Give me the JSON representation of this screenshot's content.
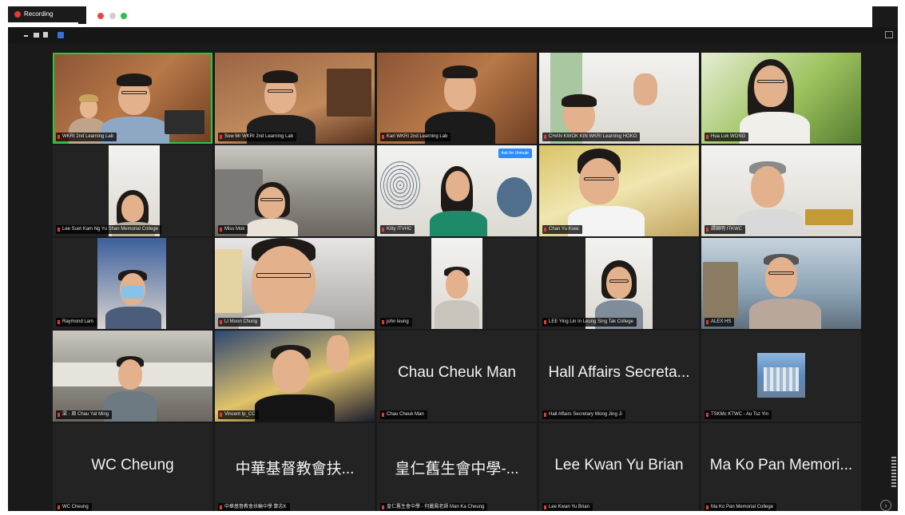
{
  "window": {
    "recording_label": "Recording",
    "accent": "#27c93f",
    "record_color": "#e53935"
  },
  "participants": [
    {
      "name": "WKRI 2nd Learning Lab",
      "video": true
    },
    {
      "name": "Sow Mr WKRI 2nd Learning Lab",
      "video": true
    },
    {
      "name": "Karl WKRI 2nd Learning Lab",
      "video": true
    },
    {
      "name": "CHAN KWOK KIN WKRI Learning HOKO",
      "video": true
    },
    {
      "name": "Hua Lok WONG",
      "video": true
    },
    {
      "name": "Lee Suet Kam Ng Yu Shan Memorial College",
      "video": true
    },
    {
      "name": "Miss Mok",
      "video": true
    },
    {
      "name": "Kitty ITVHC",
      "video": true,
      "badge": "Ask for Unmute"
    },
    {
      "name": "Chan Yu Kwai",
      "video": true
    },
    {
      "name": "譚錦明 ITKWC",
      "video": true
    },
    {
      "name": "Raymond Lam",
      "video": true
    },
    {
      "name": "LI Moon Chung",
      "video": true
    },
    {
      "name": "john leung",
      "video": true
    },
    {
      "name": "LEE Ying Lin In Leung Sing Tak College",
      "video": true
    },
    {
      "name": "ALEX HS",
      "video": true
    },
    {
      "name": "梁 - 周 Chau Yat Ming",
      "video": true
    },
    {
      "name": "Vincent Ip_CC",
      "video": true
    },
    {
      "name": "Chau Cheuk Man",
      "display": "Chau Cheuk Man",
      "video": false
    },
    {
      "name": "Hall Affairs Secretary Wong Jing Ji",
      "display": "Hall Affairs Secreta...",
      "video": false
    },
    {
      "name": "TSKMc KTWC - Au Tsz Yin",
      "video": false,
      "picture": true
    },
    {
      "name": "WC Cheung",
      "display": "WC Cheung",
      "video": false
    },
    {
      "name": "中華基督教會扶輪中學 鄭志K",
      "display": "中華基督教會扶...",
      "video": false
    },
    {
      "name": "皇仁舊生會中學 - 何麗鳳老師 Man Ka Cheung",
      "display": "皇仁舊生會中學-...",
      "video": false
    },
    {
      "name": "Lee Kwan Yu Brian",
      "display": "Lee Kwan Yu Brian",
      "video": false
    },
    {
      "name": "Ma Ko Pan Memorial College",
      "display": "Ma Ko Pan Memori...",
      "video": false
    }
  ]
}
